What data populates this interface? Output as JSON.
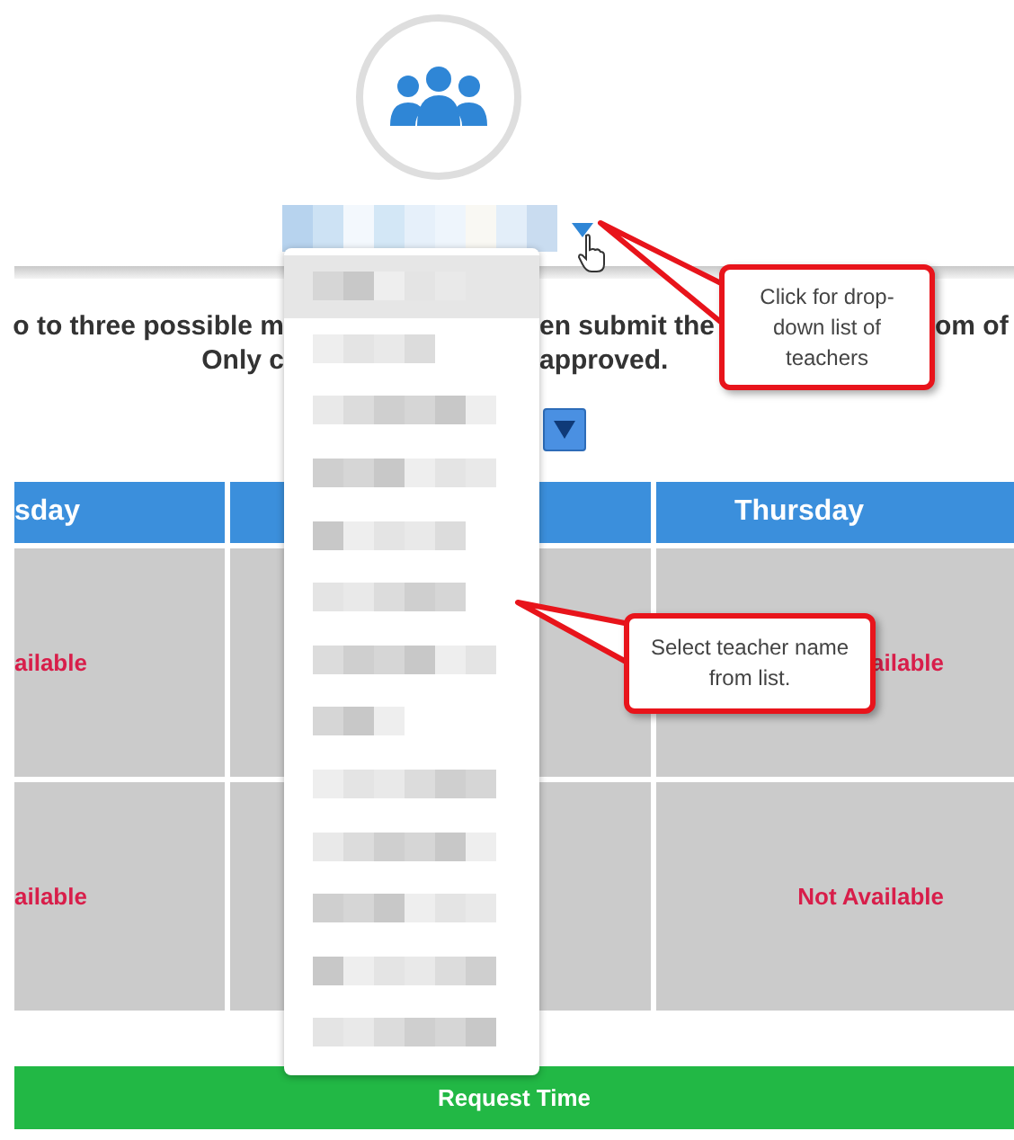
{
  "teacher_select": {
    "kind": "redacted"
  },
  "instructions": [
    {
      "segments": [
        "o to three possible m",
        "en submit the",
        "om of"
      ]
    },
    {
      "segments": [
        "Only c",
        "approved."
      ]
    }
  ],
  "table": {
    "columns": [
      "sday",
      "",
      "Thursday"
    ],
    "rows": [
      [
        "ailable",
        "",
        "ailable"
      ],
      [
        "ailable",
        "",
        "Not Available"
      ]
    ]
  },
  "request_button": "Request Time",
  "dropdown": {
    "items": [
      {
        "kind": "redacted",
        "selected": true
      },
      {
        "kind": "redacted",
        "selected": false
      },
      {
        "kind": "redacted",
        "selected": false
      },
      {
        "kind": "redacted",
        "selected": false
      },
      {
        "kind": "redacted",
        "selected": false
      },
      {
        "kind": "redacted",
        "selected": false
      },
      {
        "kind": "redacted",
        "selected": false
      },
      {
        "kind": "redacted",
        "selected": false
      },
      {
        "kind": "redacted",
        "selected": false
      },
      {
        "kind": "redacted",
        "selected": false
      },
      {
        "kind": "redacted",
        "selected": false
      },
      {
        "kind": "redacted",
        "selected": false
      },
      {
        "kind": "redacted",
        "selected": false
      }
    ]
  },
  "callouts": [
    {
      "text": "Click for drop-down list of teachers"
    },
    {
      "text": "Select teacher name from list."
    }
  ]
}
